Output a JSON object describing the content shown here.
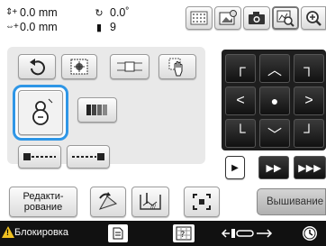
{
  "status": {
    "vertical_offset": "0.0 mm",
    "horizontal_offset": "0.0 mm",
    "rotation_angle": "0.0˚",
    "thread_count": "9"
  },
  "toolbar_icons": [
    "pattern-grid-icon",
    "image-settings-icon",
    "camera-icon",
    "scan-frame-icon",
    "zoom-icon"
  ],
  "edit_panel": {
    "icons": [
      "rotate-icon",
      "pattern-select-icon",
      "align-icon",
      "hand-move-icon",
      "thread-spool-icon",
      "color-bars-icon",
      "stitch-start-icon",
      "stitch-end-icon"
    ]
  },
  "movement": {
    "speed_labels": [
      "▶",
      "▶▶",
      "▶▶▶"
    ]
  },
  "bottom": {
    "edit_label": "Редакти-\nрование",
    "embroider_label": "Вышивание"
  },
  "footer": {
    "lock_label": "Блокировка"
  },
  "colors": {
    "selection": "#2e96e6",
    "warning": "#f0c020",
    "footer_bg": "#111111",
    "dpad_bg": "#1e1e1e"
  }
}
